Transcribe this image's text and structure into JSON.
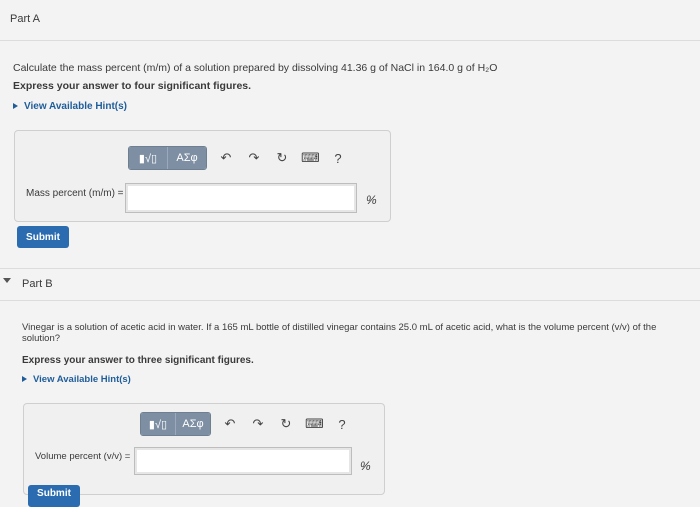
{
  "partA": {
    "title": "Part A",
    "question": "Calculate the mass percent (m/m) of a solution prepared by dissolving 41.36 g of NaCl in 164.0 g of H₂O",
    "instruction": "Express your answer to four significant figures.",
    "hints": "View Available Hint(s)",
    "toolbar": {
      "matrix": "▮√▯",
      "greek": "ΑΣφ",
      "undo": "↶",
      "redo": "↷",
      "reset": "↻",
      "keyboard": "⌨",
      "help": "?"
    },
    "answer_label": "Mass percent (m/m) =",
    "answer_value": "",
    "unit": "%",
    "submit": "Submit"
  },
  "partB": {
    "title": "Part B",
    "question_line1": "Vinegar is a solution of acetic acid in water. If a 165 mL bottle of distilled vinegar contains 25.0 mL of acetic acid, what is the volume percent (v/v) of the",
    "question_line2": "solution?",
    "instruction": "Express your answer to three significant figures.",
    "hints": "View Available Hint(s)",
    "toolbar": {
      "matrix": "▮√▯",
      "greek": "ΑΣφ",
      "undo": "↶",
      "redo": "↷",
      "reset": "↻",
      "keyboard": "⌨",
      "help": "?"
    },
    "answer_label": "Volume percent (v/v) =",
    "answer_value": "",
    "unit": "%",
    "submit": "Submit"
  }
}
